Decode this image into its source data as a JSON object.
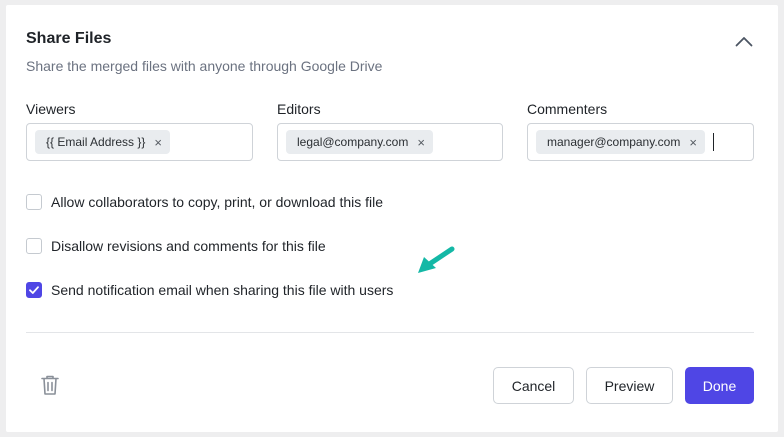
{
  "header": {
    "title": "Share Files",
    "subtitle": "Share the merged files with anyone through Google Drive"
  },
  "fields": {
    "viewers": {
      "label": "Viewers",
      "chip": "{{ Email Address }}",
      "remove": "×"
    },
    "editors": {
      "label": "Editors",
      "chip": "legal@company.com",
      "remove": "×"
    },
    "commenters": {
      "label": "Commenters",
      "chip": "manager@company.com",
      "remove": "×"
    }
  },
  "options": [
    {
      "label": "Allow collaborators to copy, print, or download this file",
      "checked": false
    },
    {
      "label": "Disallow revisions and comments for this file",
      "checked": false
    },
    {
      "label": "Send notification email when sharing this file with users",
      "checked": true
    }
  ],
  "actions": {
    "cancel": "Cancel",
    "preview": "Preview",
    "done": "Done"
  },
  "colors": {
    "primary": "#4f46e5",
    "annotation_arrow": "#14b8a6"
  },
  "icons": {
    "collapse": "chevron-up-icon",
    "delete": "trash-icon",
    "checked": "checkmark-icon",
    "annotation": "arrow-icon"
  }
}
